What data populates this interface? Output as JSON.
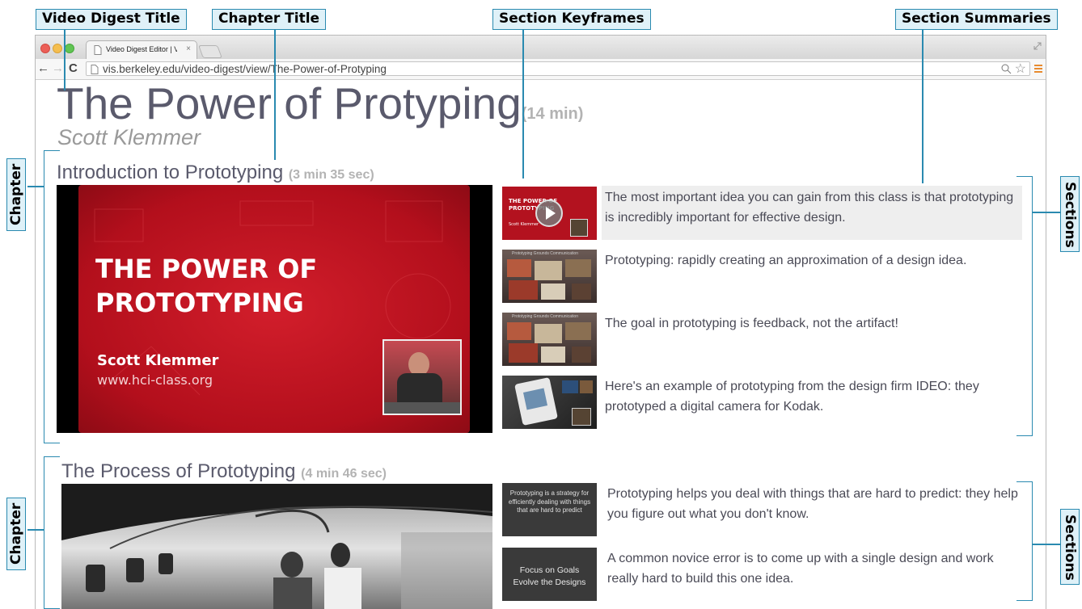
{
  "annotations": {
    "video_digest_title": "Video Digest Title",
    "chapter_title": "Chapter Title",
    "section_keyframes": "Section Keyframes",
    "section_summaries": "Section Summaries",
    "chapter": "Chapter",
    "sections": "Sections"
  },
  "browser": {
    "tab_title": "Video Digest Editor | Video",
    "url": "vis.berkeley.edu/video-digest/view/The-Power-of-Protyping"
  },
  "video": {
    "title": "The Power of Protyping",
    "duration": "(14 min)",
    "author": "Scott Klemmer"
  },
  "chapters": [
    {
      "title": "Introduction to Prototyping",
      "duration": "(3 min 35 sec)",
      "frame": {
        "heading_line1": "THE POWER OF",
        "heading_line2": "PROTOTYPING",
        "presenter": "Scott Klemmer",
        "website": "www.hci-class.org"
      },
      "sections": [
        {
          "summary": "The most important idea you can gain from this class is that prototyping is incredibly important for effective design.",
          "keyframe_text": "THE POWER OF PROTOTYPING",
          "keyframe_sub": "Scott Klemmer",
          "highlighted": true
        },
        {
          "summary": "Prototyping: rapidly creating an approximation of a design idea.",
          "keyframe_text": "Prototyping Grounds Communication"
        },
        {
          "summary": "The goal in prototyping is feedback, not the artifact!",
          "keyframe_text": "Prototyping Grounds Communication"
        },
        {
          "summary": "Here's an example of prototyping from the design firm IDEO: they prototyped a digital camera for Kodak.",
          "keyframe_text": ""
        }
      ]
    },
    {
      "title": "The Process of Prototyping",
      "duration": "(4 min 46 sec)",
      "sections": [
        {
          "summary": "Prototyping helps you deal with things that are hard to predict: they help you figure out what you don't know.",
          "keyframe_text": "Prototyping is a strategy for efficiently dealing with things that are hard to predict"
        },
        {
          "summary": "A common novice error is to come up with a single design and work really hard to build this one idea.",
          "keyframe_line1": "Focus on Goals",
          "keyframe_line2": "Evolve the Designs"
        }
      ]
    }
  ],
  "colors": {
    "annotation_border": "#2a8ab0",
    "annotation_fill": "#dff1f8",
    "title_text": "#5a5a6c",
    "duration_text": "#b3b3b3",
    "slide_red": "#c0121f"
  },
  "icons": [
    "back-arrow-icon",
    "forward-arrow-icon",
    "reload-icon",
    "page-icon",
    "zoom-icon",
    "star-icon",
    "menu-icon",
    "close-icon",
    "play-icon"
  ]
}
